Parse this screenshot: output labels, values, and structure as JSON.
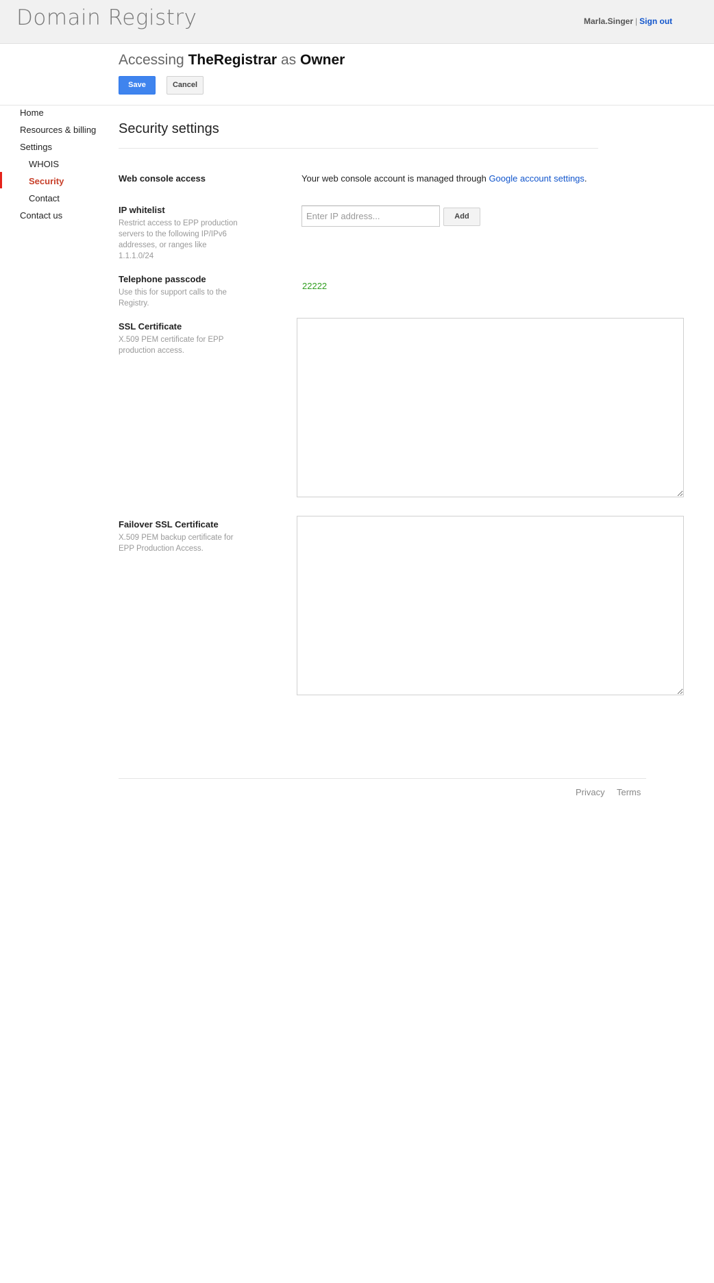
{
  "header": {
    "app_title": "Domain Registry",
    "username": "Marla.Singer",
    "separator": "|",
    "sign_out": "Sign out"
  },
  "access": {
    "prefix": "Accessing",
    "registrar": "TheRegistrar",
    "middle": "as",
    "role": "Owner",
    "save_label": "Save",
    "cancel_label": "Cancel"
  },
  "sidebar": {
    "items": [
      {
        "label": "Home"
      },
      {
        "label": "Resources & billing"
      },
      {
        "label": "Settings"
      },
      {
        "label": "WHOIS"
      },
      {
        "label": "Security",
        "active": true
      },
      {
        "label": "Contact"
      },
      {
        "label": "Contact us"
      }
    ]
  },
  "main": {
    "title": "Security settings",
    "web_console": {
      "label": "Web console access",
      "text": "Your web console account is managed through ",
      "link": "Google account settings",
      "suffix": "."
    },
    "ip_whitelist": {
      "label": "IP whitelist",
      "description": "Restrict access to EPP production servers to the following IP/IPv6 addresses, or ranges like 1.1.1.0/24",
      "placeholder": "Enter IP address...",
      "add_label": "Add"
    },
    "telephone": {
      "label": "Telephone passcode",
      "description": "Use this for support calls to the Registry.",
      "value": "22222"
    },
    "ssl": {
      "label": "SSL Certificate",
      "description": "X.509 PEM certificate for EPP production access."
    },
    "failover_ssl": {
      "label": "Failover SSL Certificate",
      "description": "X.509 PEM backup certificate for EPP Production Access."
    }
  },
  "footer": {
    "privacy": "Privacy",
    "terms": "Terms"
  },
  "colors": {
    "accent_blue": "#3f84ee",
    "link_blue": "#1155cc",
    "active_red": "#c8402a",
    "passcode_green": "#2f9e1e"
  }
}
